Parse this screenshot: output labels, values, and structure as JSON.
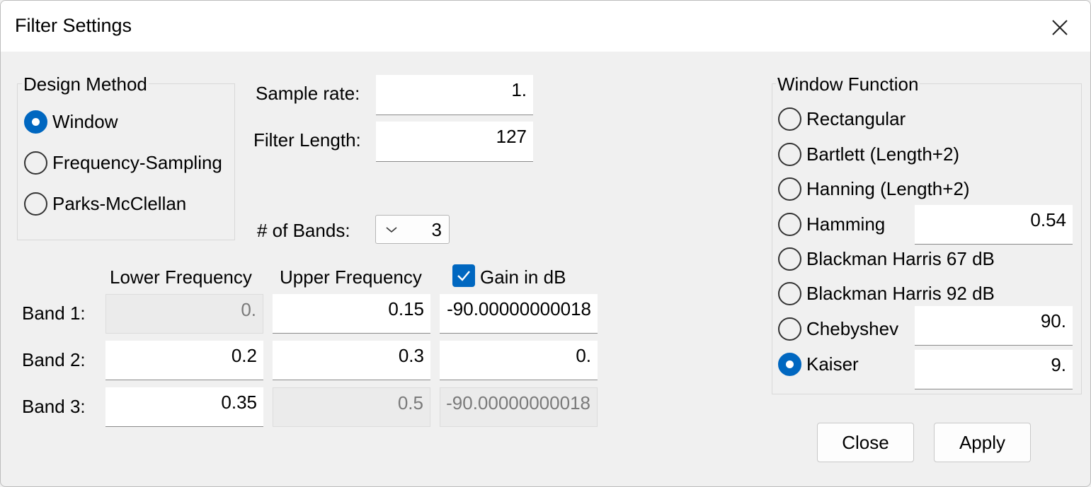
{
  "window": {
    "title": "Filter Settings"
  },
  "design_method": {
    "label": "Design Method",
    "options": [
      {
        "label": "Window",
        "checked": true
      },
      {
        "label": "Frequency-Sampling",
        "checked": false
      },
      {
        "label": "Parks-McClellan",
        "checked": false
      }
    ]
  },
  "params": {
    "sample_rate_label": "Sample rate:",
    "sample_rate_value": "1.",
    "filter_length_label": "Filter Length:",
    "filter_length_value": "127",
    "bands_label": "# of Bands:",
    "bands_value": "3"
  },
  "bands": {
    "col_lower": "Lower Frequency",
    "col_upper": "Upper Frequency",
    "col_gain": "Gain in dB",
    "gain_in_db_checked": true,
    "rows": [
      {
        "label": "Band 1:",
        "lower": "0.",
        "upper": "0.15",
        "gain": "-90.00000000018"
      },
      {
        "label": "Band 2:",
        "lower": "0.2",
        "upper": "0.3",
        "gain": "0."
      },
      {
        "label": "Band 3:",
        "lower": "0.35",
        "upper": "0.5",
        "gain": "-90.00000000018"
      }
    ]
  },
  "window_function": {
    "label": "Window Function",
    "options": [
      {
        "label": "Rectangular",
        "checked": false
      },
      {
        "label": "Bartlett (Length+2)",
        "checked": false
      },
      {
        "label": "Hanning (Length+2)",
        "checked": false
      },
      {
        "label": "Hamming",
        "checked": false,
        "param": "0.54"
      },
      {
        "label": "Blackman Harris 67 dB",
        "checked": false
      },
      {
        "label": "Blackman Harris 92 dB",
        "checked": false
      },
      {
        "label": "Chebyshev",
        "checked": false,
        "param": "90."
      },
      {
        "label": "Kaiser",
        "checked": true,
        "param": "9."
      }
    ]
  },
  "buttons": {
    "close": "Close",
    "apply": "Apply"
  },
  "colors": {
    "accent": "#0067c0",
    "background": "#f0f0f0",
    "titlebar": "#ffffff"
  }
}
